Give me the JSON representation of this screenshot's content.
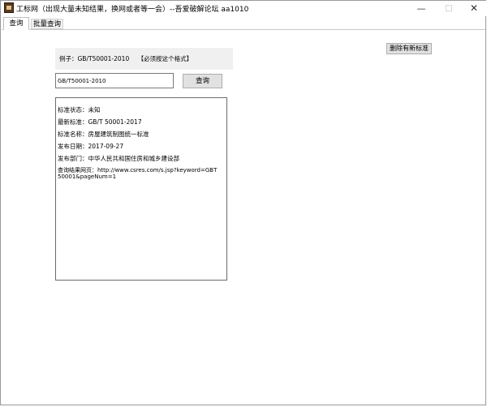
{
  "window": {
    "title": "工标网（出现大量未知结果，换网或者等一会）--吾爱破解论坛 aa1010",
    "controls": {
      "minimize": "—",
      "maximize": "□",
      "close": "✕"
    }
  },
  "tabs": [
    {
      "label": "查询",
      "active": true
    },
    {
      "label": "批量查询",
      "active": false
    }
  ],
  "query": {
    "example_label": "例子：GB/T50001-2010",
    "example_note": "【必须按这个格式】",
    "input_value": "GB/T50001-2010",
    "query_button": "查询",
    "delete_button": "删除有新标准"
  },
  "result": {
    "status_label": "标准状态：",
    "status_value": "未知",
    "latest_label": "最新标准：",
    "latest_value": "GB/T 50001-2017",
    "name_label": "标准名称：",
    "name_value": "房屋建筑制图统一标准",
    "date_label": "发布日期：",
    "date_value": "2017-09-27",
    "dept_label": "发布部门：",
    "dept_value": "中华人民共和国住房和城乡建设部",
    "url_label": "查询结果网页：",
    "url_value": "http://www.csres.com/s.jsp?keyword=GBT50001&pageNum=1"
  }
}
